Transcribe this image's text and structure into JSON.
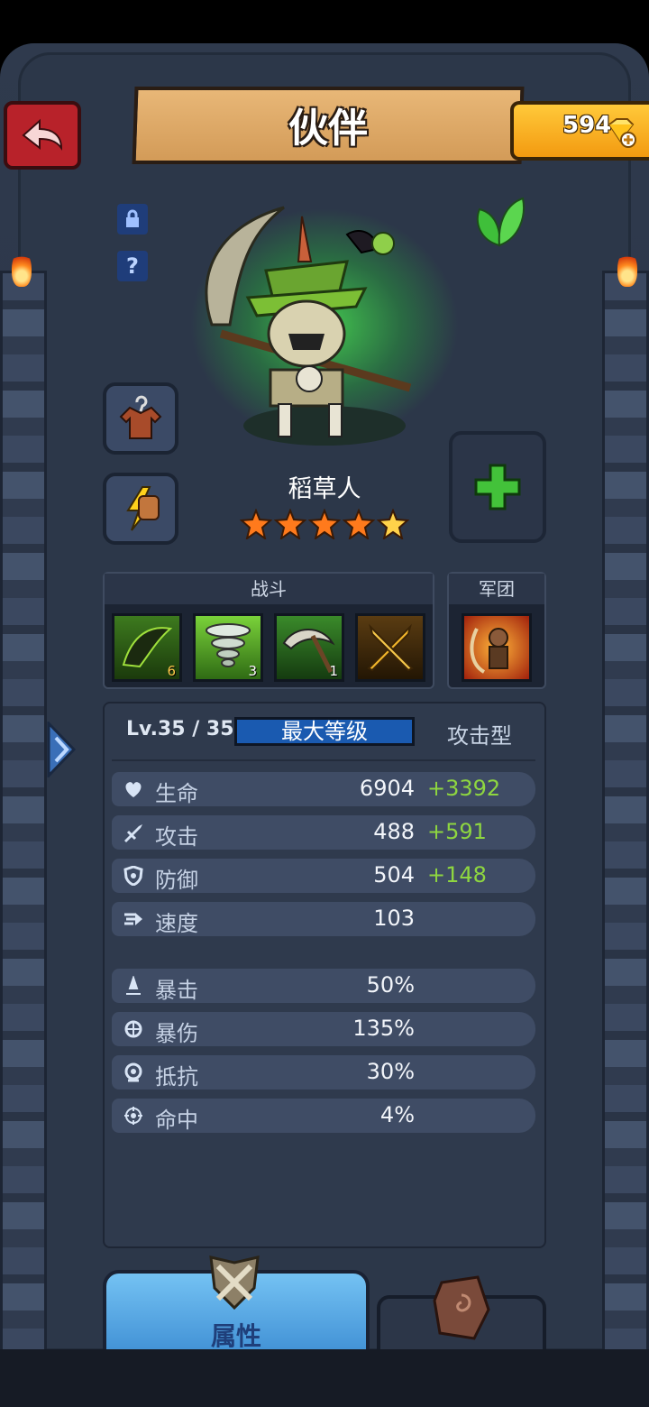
{
  "header": {
    "title": "伙伴",
    "gems": "594"
  },
  "hero": {
    "name": "稻草人",
    "stars": 5,
    "element": "leaf-icon"
  },
  "skills": {
    "combat_label": "战斗",
    "legion_label": "军团",
    "items": [
      {
        "name": "crow-skill-icon",
        "count": "6"
      },
      {
        "name": "tornado-skill-icon",
        "count": "3"
      },
      {
        "name": "scythe-skill-icon",
        "count": "1"
      },
      {
        "name": "swords-skill-icon",
        "count": ""
      }
    ],
    "legion_item": "fire-archer-icon"
  },
  "level": {
    "text": "Lv.35 / 35",
    "max_label": "最大等级",
    "type": "攻击型"
  },
  "stats": [
    {
      "icon": "heart-icon",
      "label": "生命",
      "value": "6904",
      "bonus": "+3392"
    },
    {
      "icon": "attack-icon",
      "label": "攻击",
      "value": "488",
      "bonus": "+591"
    },
    {
      "icon": "shield-icon",
      "label": "防御",
      "value": "504",
      "bonus": "+148"
    },
    {
      "icon": "speed-icon",
      "label": "速度",
      "value": "103",
      "bonus": ""
    }
  ],
  "stats2": [
    {
      "icon": "crit-icon",
      "label": "暴击",
      "value": "50%"
    },
    {
      "icon": "crit-damage-icon",
      "label": "暴伤",
      "value": "135%"
    },
    {
      "icon": "resist-icon",
      "label": "抵抗",
      "value": "30%"
    },
    {
      "icon": "accuracy-icon",
      "label": "命中",
      "value": "4%"
    }
  ],
  "tabs": {
    "attributes": "属性"
  },
  "colors": {
    "accent": "#1a5ab0",
    "bonus": "#8ed640",
    "gold": "#f39a10"
  }
}
